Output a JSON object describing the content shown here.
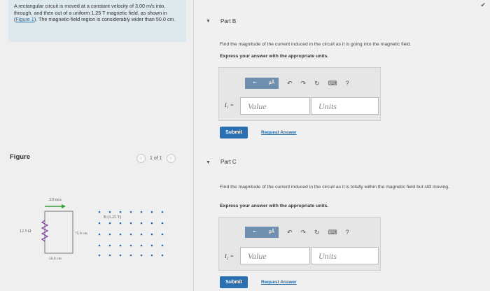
{
  "problem": {
    "text_pre": "A rectangular circuit is moved at a constant velocity of 3.00 m/s into, through, and then out of a uniform 1.25 T magnetic field, as shown in (",
    "figure_link": "Figure 1",
    "text_post": "). The magnetic-field region is considerably wider than 50.0 cm."
  },
  "figure": {
    "label": "Figure",
    "pager": "1 of 1",
    "velocity": "3.0 m/s",
    "resistance": "12.5 Ω",
    "height": "75.0 cm",
    "width": "50.0 cm",
    "field": "B (1.25 T)"
  },
  "partB": {
    "title": "Part B",
    "question": "Find the magnitude of the current induced in the circuit as it is going into the magnetic field.",
    "instruction": "Express your answer with the appropriate units.",
    "var_label": "I₁ =",
    "value_placeholder": "Value",
    "units_placeholder": "Units",
    "submit": "Submit",
    "request": "Request Answer"
  },
  "partC": {
    "title": "Part C",
    "question": "Find the magnitude of the current induced in the circuit as it is totally within the magnetic field but still moving.",
    "instruction": "Express your answer with the appropriate units.",
    "var_label": "I₂ =",
    "value_placeholder": "Value",
    "units_placeholder": "Units",
    "submit": "Submit",
    "request": "Request Answer"
  },
  "toolbar": {
    "mu_label": "μÅ",
    "help": "?"
  }
}
